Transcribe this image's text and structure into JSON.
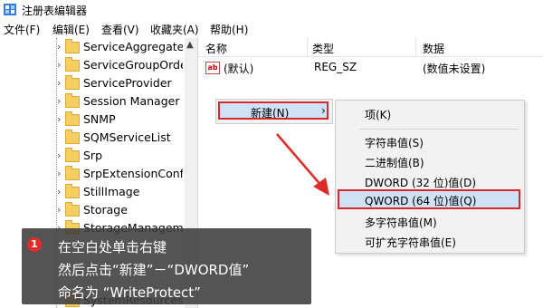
{
  "window": {
    "title": "注册表编辑器"
  },
  "menubar": [
    {
      "label": "文件(F)"
    },
    {
      "label": "编辑(E)"
    },
    {
      "label": "查看(V)"
    },
    {
      "label": "收藏夹(A)"
    },
    {
      "label": "帮助(H)"
    }
  ],
  "tree": {
    "items": [
      {
        "label": "ServiceAggregate"
      },
      {
        "label": "ServiceGroupOrde"
      },
      {
        "label": "ServiceProvider"
      },
      {
        "label": "Session Manager"
      },
      {
        "label": "SNMP"
      },
      {
        "label": "SQMServiceList"
      },
      {
        "label": "Srp"
      },
      {
        "label": "SrpExtensionConfi"
      },
      {
        "label": "StillImage"
      },
      {
        "label": "Storage"
      },
      {
        "label": "StorageManagem"
      },
      {
        "label": "SystemResources"
      }
    ]
  },
  "list": {
    "columns": [
      {
        "label": "名称"
      },
      {
        "label": "类型"
      },
      {
        "label": "数据"
      }
    ],
    "rows": [
      {
        "name": "(默认)",
        "type": "REG_SZ",
        "data": "(数值未设置)"
      }
    ]
  },
  "context_menu": {
    "new_label": "新建(N)",
    "arrow": "›"
  },
  "submenu": {
    "items": [
      {
        "label": "项(K)"
      },
      {
        "label": "字符串值(S)"
      },
      {
        "label": "二进制值(B)"
      },
      {
        "label": "DWORD (32 位)值(D)"
      },
      {
        "label": "QWORD (64 位)值(Q)"
      },
      {
        "label": "多字符串值(M)"
      },
      {
        "label": "可扩充字符串值(E)"
      }
    ]
  },
  "annotation": {
    "number": "1",
    "line1": "在空白处单击右键",
    "line2": "然后点击“新建”－“DWORD值”",
    "line3": "命名为 “WriteProtect”"
  },
  "colors": {
    "highlight": "#cfe2f6",
    "red_outline": "#d9282f",
    "folder": "#f6cf63",
    "overlay": "#3c3c3c"
  }
}
